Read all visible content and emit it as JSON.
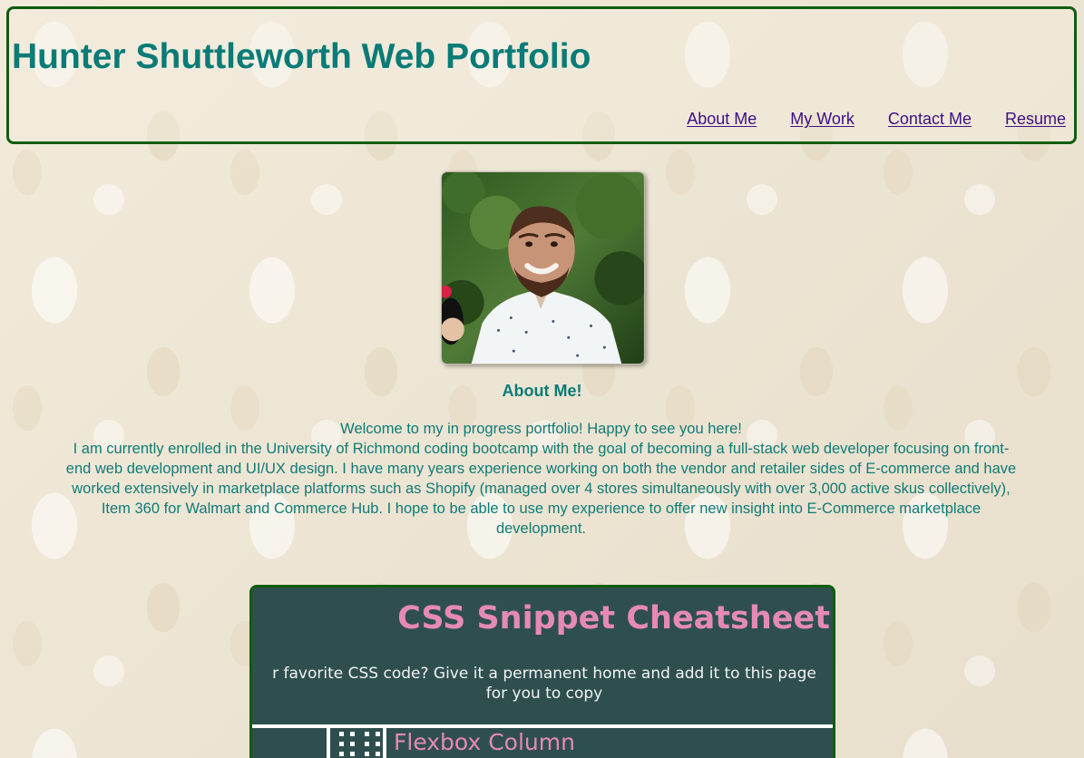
{
  "header": {
    "title": "Hunter Shuttleworth Web Portfolio",
    "nav": {
      "about": "About Me",
      "work": "My Work",
      "contact": "Contact Me",
      "resume": "Resume"
    }
  },
  "about": {
    "heading": "About Me!",
    "copy": {
      "line1": "Welcome to my in progress portfolio! Happy to see you here!",
      "line2": "I am currently enrolled in the University of Richmond coding bootcamp with the goal of becoming a full-stack web developer focusing on front-",
      "line3": "end web development and UI/UX design. I have many years experience working on both the vendor and retailer sides of E-commerce and have",
      "line4": "worked extensively in marketplace platforms such as Shopify (managed over 4 stores simultaneously with over 3,000 active skus collectively),",
      "line5": "Item 360 for Walmart and Commerce Hub. I hope to be able to use my experience to offer new insight into E-Commerce marketplace",
      "line6": "development."
    }
  },
  "project": {
    "title": "CSS Snippet Cheatsheet",
    "subtitle": {
      "line1": "r favorite CSS code? Give it a permanent home and add it to this page",
      "line2": "for you to copy"
    },
    "tab": "Flexbox Column"
  },
  "colors": {
    "border": "#0f5d0f",
    "teal": "#0a7b76",
    "nav": "#3d0f81",
    "project_bg": "#2f4f4f",
    "project_accent": "#e58ab3"
  },
  "icons": {
    "drag": "drag-handle-icon"
  }
}
